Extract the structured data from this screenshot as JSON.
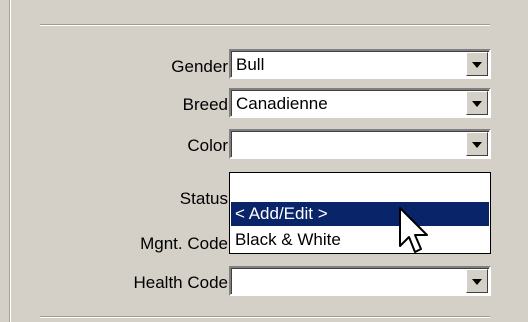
{
  "form": {
    "fields": [
      {
        "label": "Gender",
        "value": "Bull"
      },
      {
        "label": "Breed",
        "value": "Canadienne"
      },
      {
        "label": "Color",
        "value": ""
      },
      {
        "label": "Status",
        "value": ""
      },
      {
        "label": "Mgnt. Code",
        "value": ""
      },
      {
        "label": "Health Code",
        "value": ""
      }
    ],
    "color_dropdown": {
      "options": [
        "",
        "< Add/Edit >",
        "Black & White"
      ],
      "highlighted": "< Add/Edit >"
    }
  },
  "colors": {
    "window_bg": "#d4d0c8",
    "selection_bg": "#0a246a",
    "selection_text": "#ffffff"
  },
  "icons": {
    "dropdown_arrow": "chevron-down-icon",
    "pointer": "mouse-pointer-icon"
  }
}
